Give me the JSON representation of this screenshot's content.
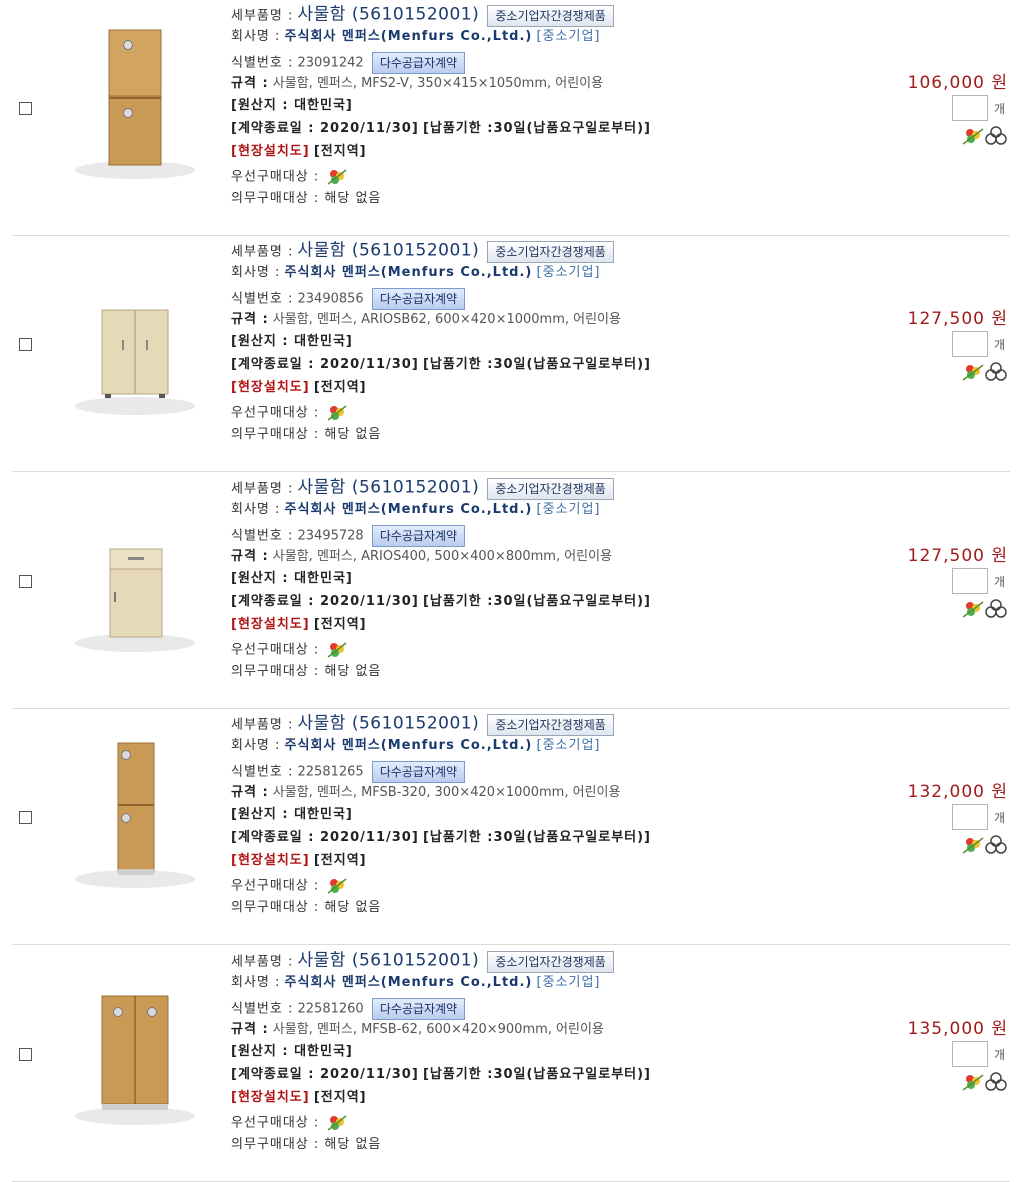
{
  "labels": {
    "detail_name": "세부품명 :",
    "company": "회사명 :",
    "sme_tag": "[중소기업]",
    "id_no": "식별번호 :",
    "multi_supplier": "다수공급자계약",
    "sme_competition": "중소기업자간경쟁제품",
    "spec": "규격 :",
    "origin": "[원산지 : 대한민국]",
    "contract_end": "[계약종료일 : 2020/11/30]",
    "delivery": "[납품기한 :30일(납품요구일로부터)]",
    "install": "[현장설치도]",
    "install_area": "[전지역]",
    "priority": "우선구매대상 :",
    "mandatory": "의무구매대상 : 해당 없음",
    "unit": "개"
  },
  "company_name": "주식회사 멘퍼스(Menfurs Co.,Ltd.)",
  "product_name": "사물함 (5610152001)",
  "items": [
    {
      "id": "23091242",
      "spec": "사물함, 멘퍼스, MFS2-V, 350×415×1050mm, 어린이용",
      "price": "106,000 원",
      "style": "tall2"
    },
    {
      "id": "23490856",
      "spec": "사물함, 멘퍼스, ARIOSB62, 600×420×1000mm, 어린이용",
      "price": "127,500 원",
      "style": "wide2light"
    },
    {
      "id": "23495728",
      "spec": "사물함, 멘퍼스, ARIOS400, 500×400×800mm, 어린이용",
      "price": "127,500 원",
      "style": "drawer"
    },
    {
      "id": "22581265",
      "spec": "사물함, 멘퍼스, MFSB-320, 300×420×1000mm, 어린이용",
      "price": "132,000 원",
      "style": "slim2"
    },
    {
      "id": "22581260",
      "spec": "사물함, 멘퍼스, MFSB-62, 600×420×900mm, 어린이용",
      "price": "135,000 원",
      "style": "wide2wood"
    }
  ],
  "colors": {
    "price": "#a01b1b",
    "company": "#1a3a6e",
    "install_red": "#b01515",
    "wood": "#c89a55",
    "light_wood": "#e6d9b8"
  }
}
